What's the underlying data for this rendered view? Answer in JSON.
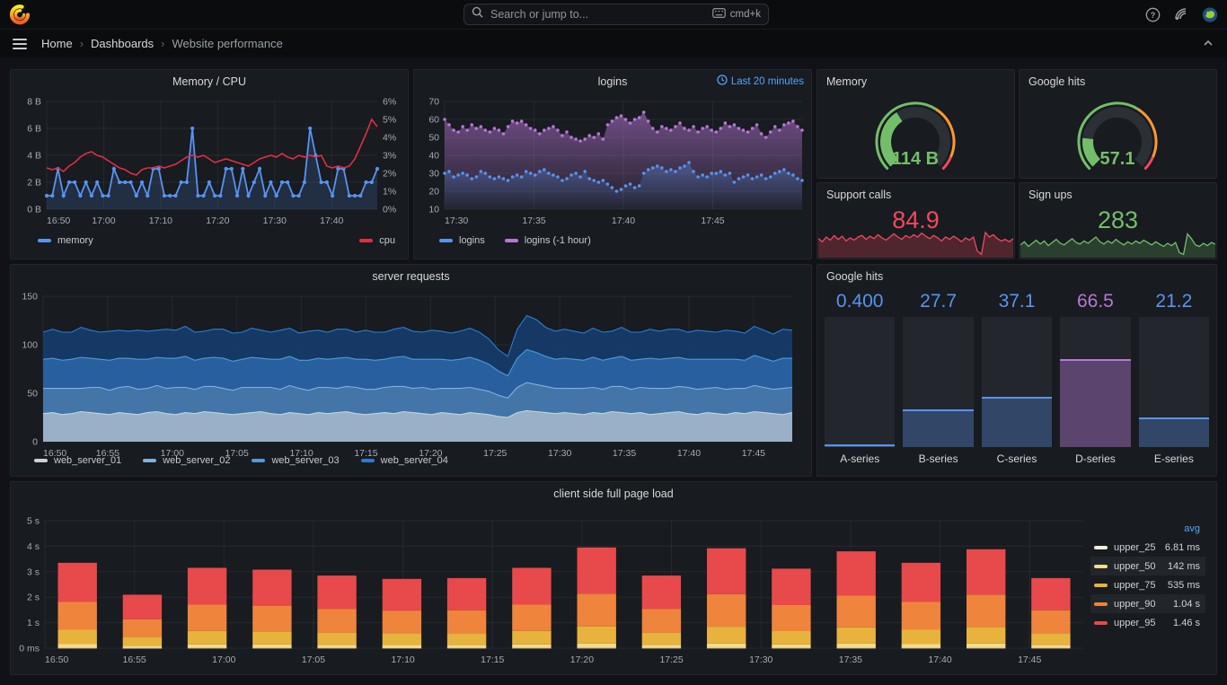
{
  "topbar": {
    "search_placeholder": "Search or jump to...",
    "search_shortcut": "cmd+k"
  },
  "breadcrumb": {
    "items": [
      "Home",
      "Dashboards",
      "Website performance"
    ],
    "separator": "›"
  },
  "colors": {
    "page_bg": "#111217",
    "header_bg": "#0b0c0e",
    "panel_bg": "#181b1f",
    "panel_border": "#23262b",
    "title": "#d8d9da",
    "axis": "#a6adb5",
    "grid": "rgba(204,212,220,0.08)",
    "blue": "#5794F2",
    "red": "#E02F44",
    "purple": "#B877D9",
    "green": "#73BF69",
    "orange": "#FF9830",
    "stat_red": "#F2495C",
    "link_blue": "#4FA7FF"
  },
  "panels": {
    "memory_cpu": {
      "title": "Memory / CPU",
      "chart_data": {
        "type": "line",
        "x_ticks": [
          "16:50",
          "17:00",
          "17:10",
          "17:20",
          "17:30",
          "17:40"
        ],
        "x_tick_pos": [
          0,
          0.1724,
          0.3448,
          0.5172,
          0.6897,
          0.8621
        ],
        "y_left_ticks": [
          "0 B",
          "2 B",
          "4 B",
          "6 B",
          "8 B"
        ],
        "y_left_max": 8,
        "y_right_ticks": [
          "0%",
          "1%",
          "2%",
          "3%",
          "4%",
          "5%",
          "6%"
        ],
        "y_right_max": 6,
        "series": [
          {
            "name": "memory",
            "color": "#5794F2",
            "axis": "left",
            "values": [
              1,
              1,
              3,
              1,
              2,
              2,
              1,
              2,
              1,
              2,
              1,
              1,
              3,
              2,
              2,
              2,
              1,
              2,
              1,
              3,
              3,
              1,
              1,
              1,
              2,
              2,
              6,
              1,
              1,
              2,
              1,
              1,
              3,
              3,
              1,
              3,
              1,
              2,
              3,
              1,
              2,
              1,
              2,
              2,
              1,
              1,
              2,
              6,
              4,
              2,
              2,
              1,
              3,
              3,
              1,
              1,
              1,
              2,
              2,
              3
            ]
          },
          {
            "name": "cpu",
            "color": "#E02F44",
            "axis": "right",
            "values": [
              2.3,
              2.2,
              2.3,
              2.1,
              2.4,
              2.6,
              2.9,
              3.1,
              3.2,
              3.0,
              2.9,
              2.7,
              2.5,
              2.3,
              2.2,
              2.0,
              1.9,
              2.2,
              2.3,
              2.3,
              2.4,
              2.3,
              2.4,
              2.5,
              2.7,
              2.9,
              3.0,
              2.9,
              3.0,
              2.8,
              2.6,
              2.7,
              2.8,
              2.7,
              2.6,
              2.5,
              2.4,
              2.6,
              2.8,
              2.9,
              3.0,
              2.9,
              3.1,
              2.9,
              2.8,
              3.0,
              2.9,
              3.0,
              2.9,
              3.0,
              2.4,
              2.3,
              2.4,
              2.3,
              2.4,
              2.8,
              3.5,
              4.2,
              5.0,
              4.6
            ]
          }
        ]
      }
    },
    "logins": {
      "title": "logins",
      "time_range": "Last 20 minutes",
      "chart_data": {
        "type": "scatter",
        "x_ticks": [
          "17:30",
          "17:35",
          "17:40",
          "17:45"
        ],
        "x_tick_pos": [
          0,
          0.25,
          0.5,
          0.75
        ],
        "y_ticks": [
          "10",
          "20",
          "30",
          "40",
          "50",
          "60",
          "70"
        ],
        "y_min": 10,
        "y_max": 70,
        "series": [
          {
            "name": "logins",
            "color": "#5794F2",
            "values": [
              30,
              31,
              28,
              29,
              30,
              29,
              27,
              28,
              31,
              30,
              28,
              27,
              28,
              27,
              26,
              28,
              29,
              28,
              31,
              30,
              29,
              31,
              32,
              30,
              29,
              28,
              26,
              27,
              29,
              30,
              28,
              31,
              27,
              26,
              25,
              26,
              24,
              22,
              20,
              21,
              23,
              24,
              22,
              23,
              30,
              32,
              33,
              34,
              33,
              31,
              32,
              31,
              33,
              34,
              36,
              31,
              28,
              29,
              28,
              30,
              30,
              31,
              29,
              30,
              25,
              27,
              28,
              29,
              27,
              28,
              29,
              27,
              28,
              30,
              31,
              32,
              30,
              29,
              27,
              26
            ]
          },
          {
            "name": "logins (-1 hour)",
            "color": "#B877D9",
            "values": [
              60,
              57,
              54,
              53,
              56,
              54,
              57,
              55,
              56,
              54,
              53,
              55,
              54,
              52,
              56,
              59,
              58,
              59,
              57,
              55,
              54,
              52,
              54,
              55,
              56,
              54,
              51,
              53,
              50,
              49,
              48,
              49,
              51,
              50,
              52,
              49,
              57,
              59,
              61,
              62,
              60,
              58,
              60,
              61,
              64,
              59,
              55,
              53,
              56,
              55,
              54,
              56,
              58,
              55,
              54,
              56,
              53,
              55,
              56,
              54,
              53,
              55,
              58,
              56,
              57,
              55,
              54,
              53,
              55,
              57,
              52,
              50,
              53,
              56,
              54,
              57,
              58,
              59,
              56,
              54
            ]
          }
        ]
      }
    },
    "memory_gauge": {
      "title": "Memory",
      "value": "114 B",
      "fill_fraction": 0.38,
      "thresholds": [
        {
          "color": "#73BF69",
          "from": 0,
          "to": 0.62
        },
        {
          "color": "#FF9830",
          "from": 0.62,
          "to": 0.92
        },
        {
          "color": "#F2495C",
          "from": 0.92,
          "to": 1
        }
      ]
    },
    "google_gauge": {
      "title": "Google hits",
      "value": "57.1",
      "fill_fraction": 0.19,
      "thresholds": [
        {
          "color": "#73BF69",
          "from": 0,
          "to": 0.62
        },
        {
          "color": "#FF9830",
          "from": 0.62,
          "to": 0.92
        },
        {
          "color": "#F2495C",
          "from": 0.92,
          "to": 1
        }
      ]
    },
    "support_calls": {
      "title": "Support calls",
      "value": "84.9",
      "color": "#F2495C",
      "spark": [
        22,
        18,
        24,
        20,
        26,
        21,
        25,
        19,
        23,
        20,
        24,
        26,
        21,
        25,
        22,
        27,
        23,
        20,
        24,
        28,
        24,
        21,
        26,
        23,
        27,
        24,
        29,
        25,
        22,
        26,
        23,
        19,
        24,
        21,
        25,
        22,
        18,
        23,
        20,
        24,
        6,
        2,
        30,
        24,
        27,
        22,
        19,
        21,
        18,
        22
      ]
    },
    "sign_ups": {
      "title": "Sign ups",
      "value": "283",
      "color": "#73BF69",
      "spark": [
        14,
        18,
        12,
        16,
        20,
        15,
        19,
        13,
        17,
        21,
        16,
        14,
        18,
        22,
        17,
        15,
        19,
        16,
        20,
        24,
        18,
        15,
        19,
        16,
        21,
        17,
        14,
        18,
        15,
        19,
        16,
        20,
        17,
        14,
        18,
        15,
        12,
        16,
        13,
        17,
        4,
        2,
        28,
        22,
        14,
        12,
        16,
        13,
        17,
        15
      ]
    },
    "server_requests": {
      "title": "server requests",
      "chart_data": {
        "type": "area",
        "stacked": true,
        "x_ticks": [
          "16:50",
          "16:55",
          "17:00",
          "17:05",
          "17:10",
          "17:15",
          "17:20",
          "17:25",
          "17:30",
          "17:35",
          "17:40",
          "17:45"
        ],
        "y_ticks": [
          "0",
          "50",
          "100",
          "150"
        ],
        "y_max": 150,
        "series": [
          {
            "name": "web_server_01",
            "line": "#C9D2DA",
            "fill": "rgba(199,208,217,0.65)",
            "values": [
              29,
              30,
              28,
              29,
              31,
              30,
              29,
              28,
              30,
              29,
              28,
              30,
              31,
              29,
              28,
              30,
              29,
              31,
              30,
              29,
              28,
              29,
              30,
              31,
              29,
              28,
              30,
              29,
              28,
              30,
              29,
              30,
              31,
              29,
              28,
              29,
              30,
              29,
              31,
              30,
              29,
              28,
              30,
              29,
              28,
              30,
              29,
              28,
              26,
              25,
              30,
              32,
              31,
              30,
              29,
              30,
              29,
              28,
              30,
              29,
              31,
              30,
              29,
              30,
              28,
              29,
              30,
              31,
              29,
              28,
              30,
              29,
              28,
              30,
              29,
              31,
              30,
              29,
              28,
              30
            ]
          },
          {
            "name": "web_server_02",
            "line": "#7FB2DD",
            "fill": "rgba(86,130,175,0.62)",
            "values": [
              26,
              25,
              27,
              26,
              24,
              26,
              27,
              25,
              26,
              28,
              26,
              25,
              27,
              26,
              28,
              26,
              25,
              26,
              27,
              26,
              25,
              27,
              26,
              25,
              27,
              26,
              28,
              26,
              25,
              26,
              27,
              25,
              26,
              27,
              26,
              25,
              26,
              28,
              26,
              25,
              27,
              26,
              25,
              26,
              27,
              26,
              25,
              24,
              22,
              20,
              26,
              29,
              28,
              27,
              26,
              25,
              26,
              27,
              26,
              25,
              26,
              27,
              25,
              26,
              27,
              26,
              25,
              26,
              27,
              26,
              25,
              27,
              26,
              25,
              26,
              27,
              26,
              25,
              27,
              26
            ]
          },
          {
            "name": "web_server_03",
            "line": "#4F9BDE",
            "fill": "rgba(47,110,181,0.72)",
            "values": [
              30,
              31,
              29,
              30,
              32,
              30,
              29,
              31,
              30,
              29,
              31,
              30,
              29,
              31,
              30,
              32,
              30,
              29,
              30,
              31,
              30,
              29,
              31,
              30,
              29,
              31,
              30,
              29,
              31,
              30,
              29,
              31,
              30,
              29,
              31,
              30,
              29,
              30,
              31,
              30,
              29,
              31,
              30,
              29,
              30,
              31,
              30,
              28,
              25,
              23,
              30,
              34,
              33,
              31,
              30,
              31,
              30,
              29,
              31,
              30,
              29,
              31,
              30,
              29,
              31,
              30,
              31,
              30,
              29,
              31,
              30,
              29,
              31,
              30,
              29,
              31,
              30,
              29,
              31,
              30
            ]
          },
          {
            "name": "web_server_04",
            "line": "#2B7CD3",
            "fill": "rgba(20,62,110,0.88)",
            "values": [
              28,
              30,
              29,
              28,
              31,
              29,
              28,
              30,
              29,
              28,
              30,
              29,
              28,
              30,
              29,
              31,
              29,
              28,
              29,
              30,
              29,
              28,
              30,
              29,
              28,
              30,
              29,
              28,
              30,
              29,
              28,
              30,
              29,
              28,
              30,
              29,
              28,
              29,
              30,
              29,
              28,
              30,
              29,
              28,
              29,
              30,
              29,
              26,
              22,
              20,
              30,
              35,
              34,
              30,
              29,
              30,
              29,
              28,
              30,
              29,
              28,
              30,
              29,
              28,
              30,
              29,
              30,
              29,
              28,
              30,
              29,
              28,
              30,
              29,
              28,
              30,
              29,
              28,
              30,
              29
            ]
          }
        ]
      }
    },
    "google_bars": {
      "title": "Google hits",
      "chart_data": {
        "type": "bar",
        "max": 100,
        "categories": [
          "A-series",
          "B-series",
          "C-series",
          "D-series",
          "E-series"
        ],
        "values": [
          0.4,
          27.7,
          37.1,
          66.5,
          21.2
        ],
        "labels": [
          "0.400",
          "27.7",
          "37.1",
          "66.5",
          "21.2"
        ],
        "colors": [
          "#5794F2",
          "#5794F2",
          "#5794F2",
          "#B877D9",
          "#5794F2"
        ],
        "fills": [
          "rgba(87,148,242,0.30)",
          "rgba(87,148,242,0.30)",
          "rgba(87,148,242,0.30)",
          "rgba(184,119,217,0.38)",
          "rgba(87,148,242,0.30)"
        ]
      }
    },
    "page_load": {
      "title": "client side full page load",
      "legend_header": "avg",
      "chart_data": {
        "type": "bar",
        "stacked": true,
        "x_ticks": [
          "16:50",
          "16:55",
          "17:00",
          "17:05",
          "17:10",
          "17:15",
          "17:20",
          "17:25",
          "17:30",
          "17:35",
          "17:40",
          "17:45"
        ],
        "y_ticks": [
          "0 ms",
          "1 s",
          "2 s",
          "3 s",
          "4 s",
          "5 s"
        ],
        "y_max": 5,
        "totals": [
          3.35,
          2.1,
          3.15,
          3.08,
          2.85,
          2.72,
          2.75,
          3.15,
          3.95,
          2.85,
          3.92,
          3.12,
          3.8,
          3.35,
          3.88,
          2.75
        ],
        "stack_fractions": [
          0.002,
          0.045,
          0.168,
          0.327,
          0.458
        ],
        "series": [
          {
            "name": "upper_25",
            "color": "#F2EEDC",
            "avg": "6.81 ms"
          },
          {
            "name": "upper_50",
            "color": "#F5DB8B",
            "avg": "142 ms"
          },
          {
            "name": "upper_75",
            "color": "#E8B33C",
            "avg": "535 ms"
          },
          {
            "name": "upper_90",
            "color": "#EF843C",
            "avg": "1.04 s"
          },
          {
            "name": "upper_95",
            "color": "#E8494A",
            "avg": "1.46 s"
          }
        ]
      }
    }
  }
}
